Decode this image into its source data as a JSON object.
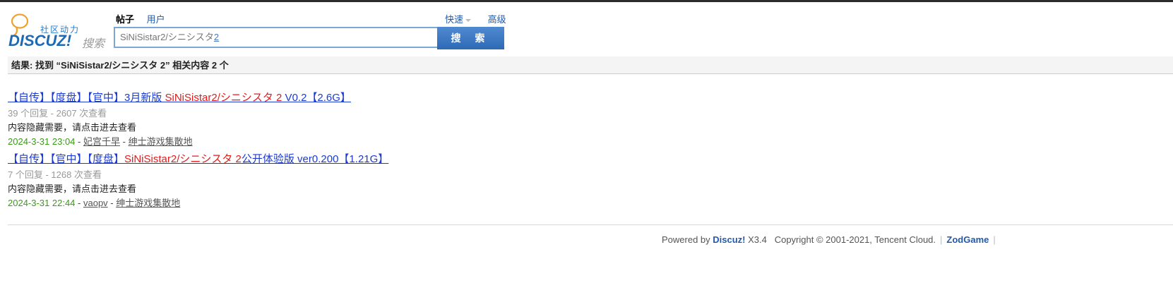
{
  "logo": {
    "tagline": "社区动力",
    "brand": "DISCUZ!",
    "suffix": "搜索"
  },
  "tabs": [
    {
      "label": "帖子",
      "active": true
    },
    {
      "label": "用户",
      "active": false
    }
  ],
  "right_links": {
    "quick": "快速",
    "advanced": "高级"
  },
  "search": {
    "value_main": "SiNiSistar2/シニシスタ",
    "value_tail": "2",
    "button": "搜 索"
  },
  "result_summary": "结果: 找到 “SiNiSistar2/シニシスタ 2” 相关内容 2 个",
  "results": [
    {
      "title_prefix": "【自传】【度盘】【官中】3月新版 ",
      "title_highlight": "SiNiSistar2/シニシスタ 2",
      "title_suffix": " V0.2【2.6G】",
      "meta": "39 个回复 - 2607 次查看",
      "desc": "内容隐藏需要，请点击进去查看",
      "date": "2024-3-31 23:04",
      "author": "妃宫千早",
      "forum": "绅士游戏集散地"
    },
    {
      "title_prefix": "【自传】【官中】【度盘】",
      "title_highlight": "SiNiSistar2/シニシスタ 2",
      "title_suffix": "公开体验版 ver0.200【1.21G】",
      "meta": "7 个回复 - 1268 次查看",
      "desc": "内容隐藏需要，请点击进去查看",
      "date": "2024-3-31 22:44",
      "author": "vaopv",
      "forum": "绅士游戏集散地"
    }
  ],
  "footer": {
    "powered_by": "Powered by ",
    "discuz": "Discuz!",
    "version": " X3.4",
    "copyright": "Copyright © 2001-2021, Tencent Cloud.",
    "site": "ZodGame"
  }
}
